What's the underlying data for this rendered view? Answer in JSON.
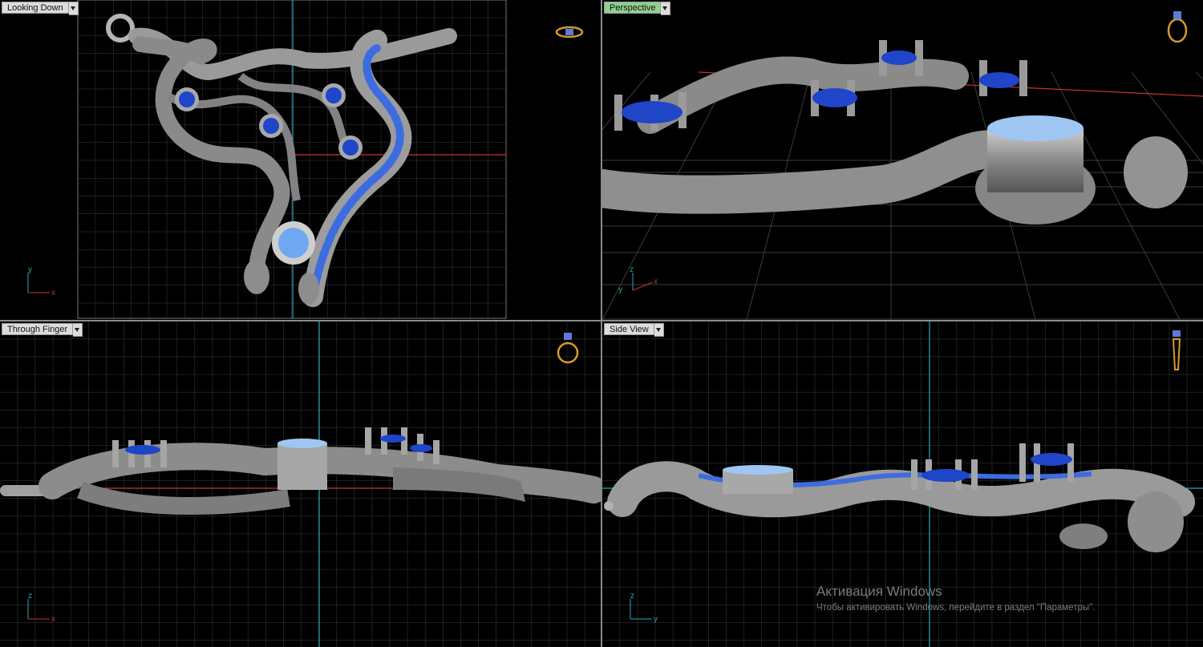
{
  "viewports": [
    {
      "id": "top",
      "label": "Looking Down",
      "active": false,
      "axes": [
        "y",
        "x"
      ]
    },
    {
      "id": "perspective",
      "label": "Perspective",
      "active": true,
      "axes": [
        "z",
        "y",
        "x"
      ]
    },
    {
      "id": "front",
      "label": "Through Finger",
      "active": false,
      "axes": [
        "z",
        "x"
      ]
    },
    {
      "id": "side",
      "label": "Side View",
      "active": false,
      "axes": [
        "z",
        "y"
      ]
    }
  ],
  "view_cube_icons": [
    "ring-top-view-icon",
    "ring-perspective-icon",
    "ring-front-view-icon",
    "ring-side-view-icon"
  ],
  "watermark": {
    "title": "Активация Windows",
    "subtitle": "Чтобы активировать Windows, перейдите в раздел \"Параметры\"."
  },
  "colors": {
    "background": "#000000",
    "grid": "#3a3a3a",
    "axis_x": "#c83232",
    "axis_y": "#2aa6c0",
    "metal": "#8c8c8c",
    "gem": "#2a4fd8",
    "active_label": "#8fd18f"
  }
}
